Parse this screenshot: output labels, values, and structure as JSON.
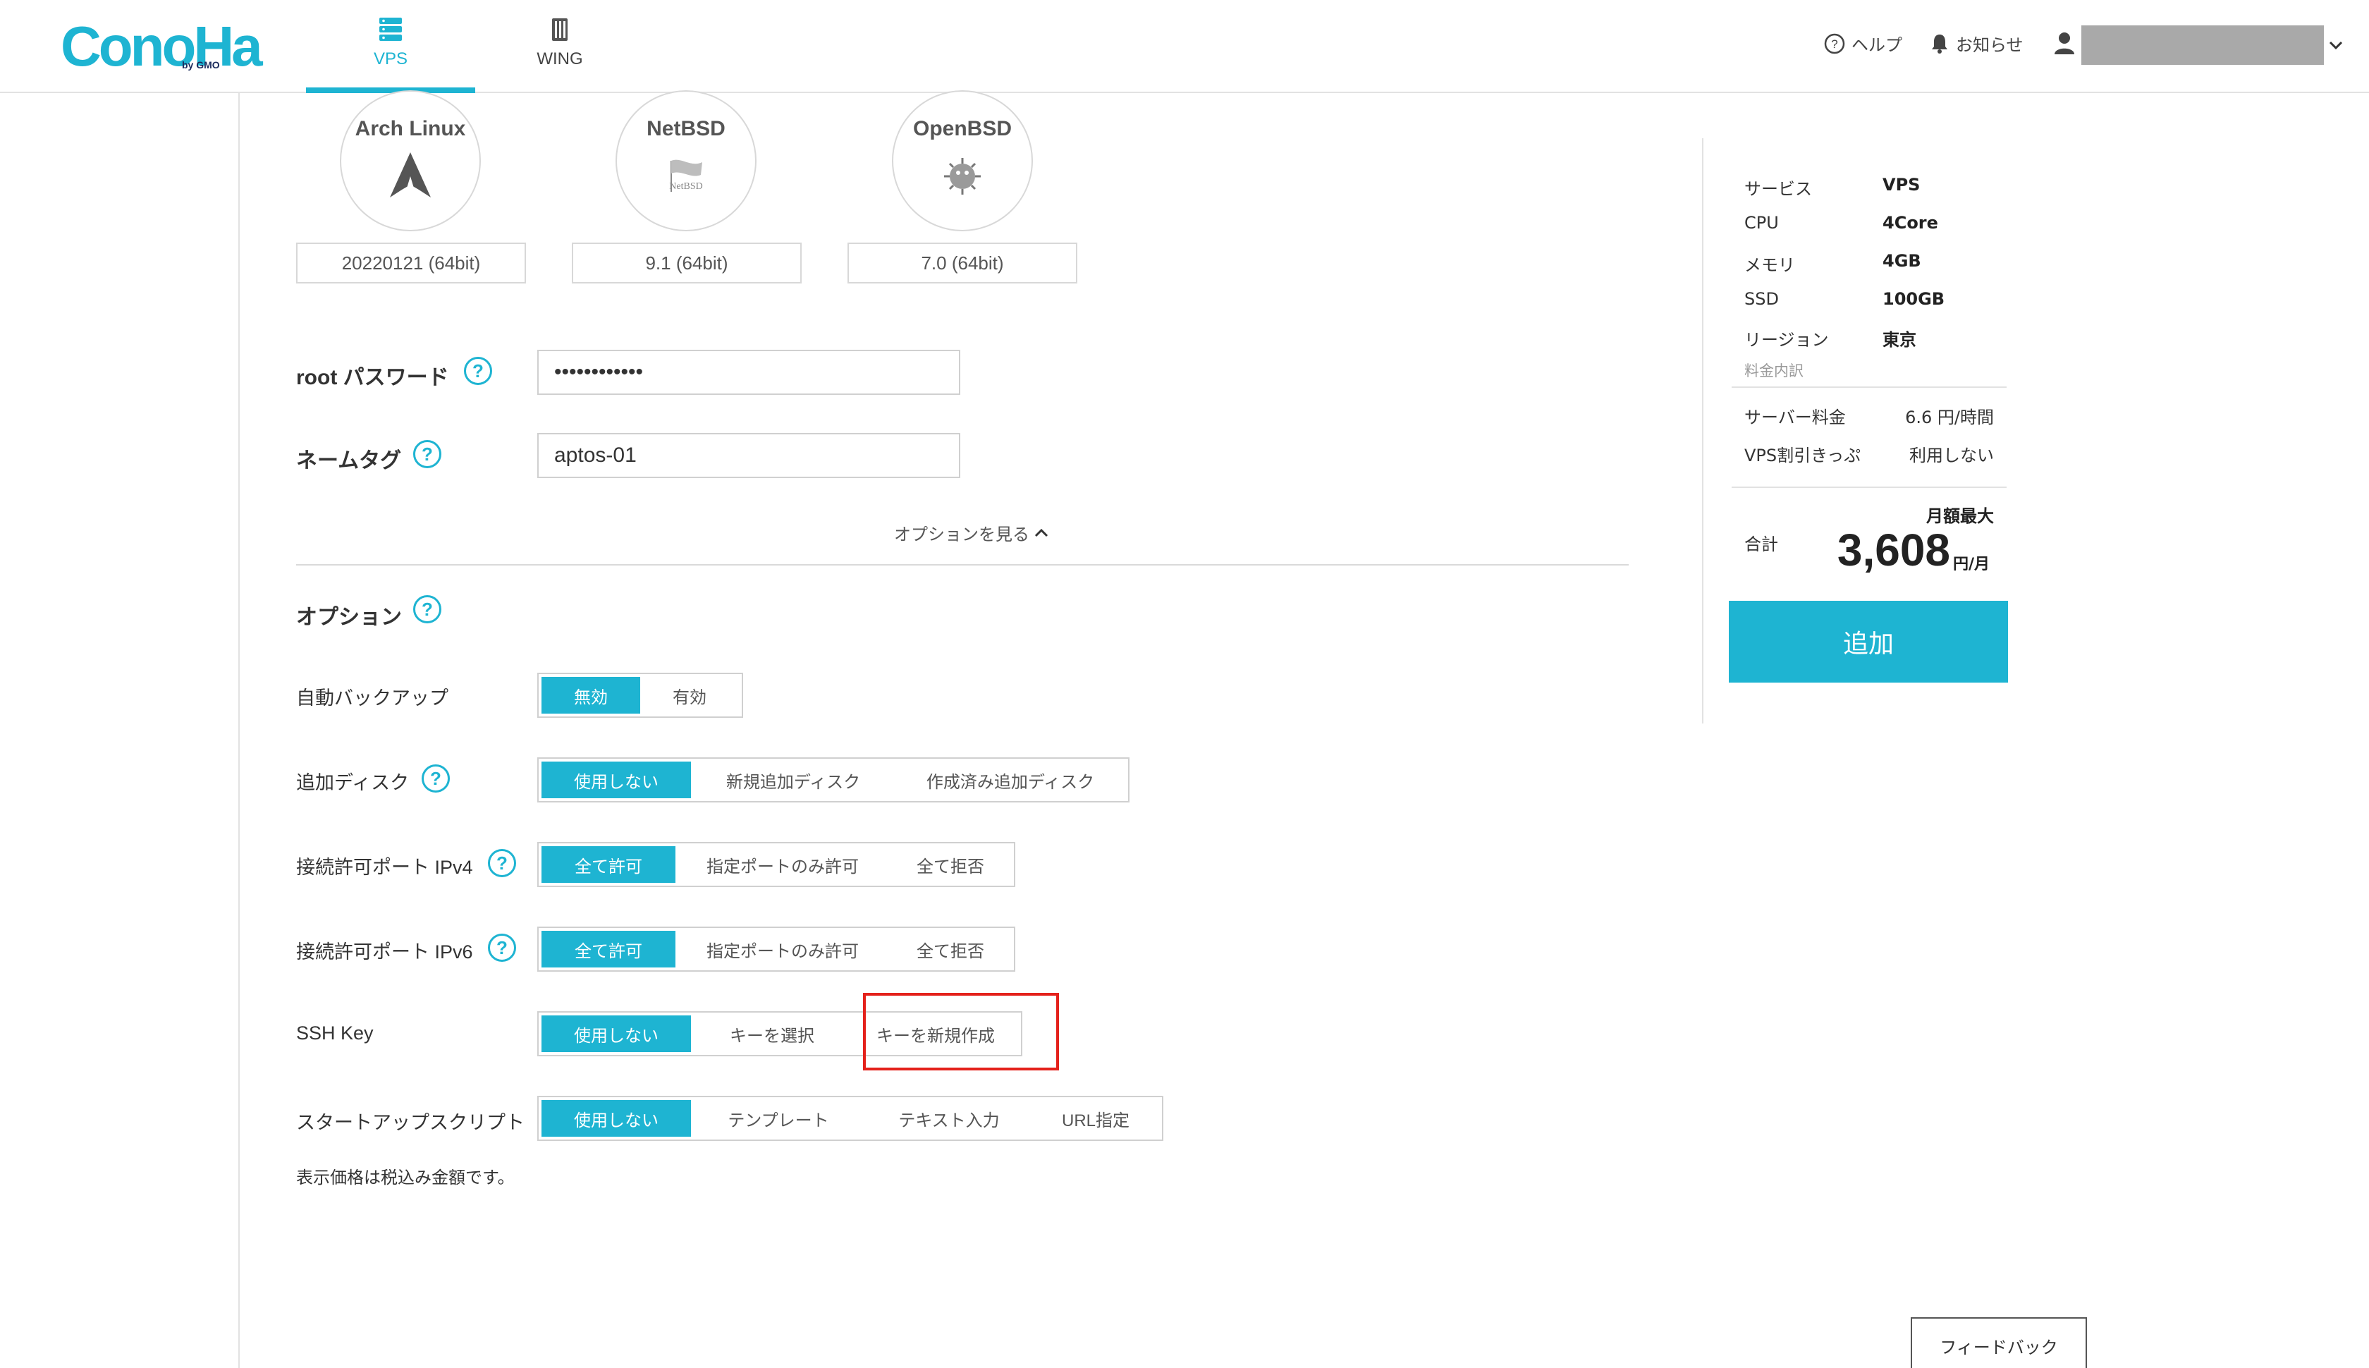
{
  "header": {
    "logo": "ConoHa",
    "logo_sub": "by GMO",
    "tabs": [
      {
        "label": "VPS",
        "icon": "server-stack-icon"
      },
      {
        "label": "WING",
        "icon": "wing-server-icon"
      }
    ],
    "help": "ヘルプ",
    "notifications": "お知らせ"
  },
  "os_templates": [
    {
      "name": "Arch Linux",
      "version": "20220121 (64bit)"
    },
    {
      "name": "NetBSD",
      "version": "9.1 (64bit)"
    },
    {
      "name": "OpenBSD",
      "version": "7.0 (64bit)"
    }
  ],
  "form": {
    "root_password_label": "root パスワード",
    "root_password_value": "••••••••••••",
    "name_tag_label": "ネームタグ",
    "name_tag_value": "aptos-01",
    "options_toggle": "オプションを見る",
    "options_heading": "オプション"
  },
  "options": [
    {
      "label": "自動バックアップ",
      "segments": [
        "無効",
        "有効"
      ]
    },
    {
      "label": "追加ディスク",
      "segments": [
        "使用しない",
        "新規追加ディスク",
        "作成済み追加ディスク"
      ]
    },
    {
      "label": "接続許可ポート IPv4",
      "segments": [
        "全て許可",
        "指定ポートのみ許可",
        "全て拒否"
      ]
    },
    {
      "label": "接続許可ポート IPv6",
      "segments": [
        "全て許可",
        "指定ポートのみ許可",
        "全て拒否"
      ]
    },
    {
      "label": "SSH Key",
      "segments": [
        "使用しない",
        "キーを選択",
        "キーを新規作成"
      ]
    },
    {
      "label": "スタートアップスクリプト",
      "segments": [
        "使用しない",
        "テンプレート",
        "テキスト入力",
        "URL指定"
      ]
    }
  ],
  "tax_note": "表示価格は税込み金額です。",
  "summary": {
    "specs": [
      {
        "key": "サービス",
        "value": "VPS"
      },
      {
        "key": "CPU",
        "value": "4Core"
      },
      {
        "key": "メモリ",
        "value": "4GB"
      },
      {
        "key": "SSD",
        "value": "100GB"
      },
      {
        "key": "リージョン",
        "value": "東京"
      }
    ],
    "price_detail": "料金内訳",
    "fees": [
      {
        "key": "サーバー料金",
        "value": "6.6 円/時間"
      },
      {
        "key": "VPS割引きっぷ",
        "value": "利用しない"
      }
    ],
    "monthly_max": "月額最大",
    "total_label": "合計",
    "total_price": "3,608",
    "total_unit": "円/月",
    "add_button": "追加"
  },
  "feedback_button": "フィードバック",
  "colors": {
    "accent": "#1eb4d2",
    "highlight": "#e4211b"
  }
}
